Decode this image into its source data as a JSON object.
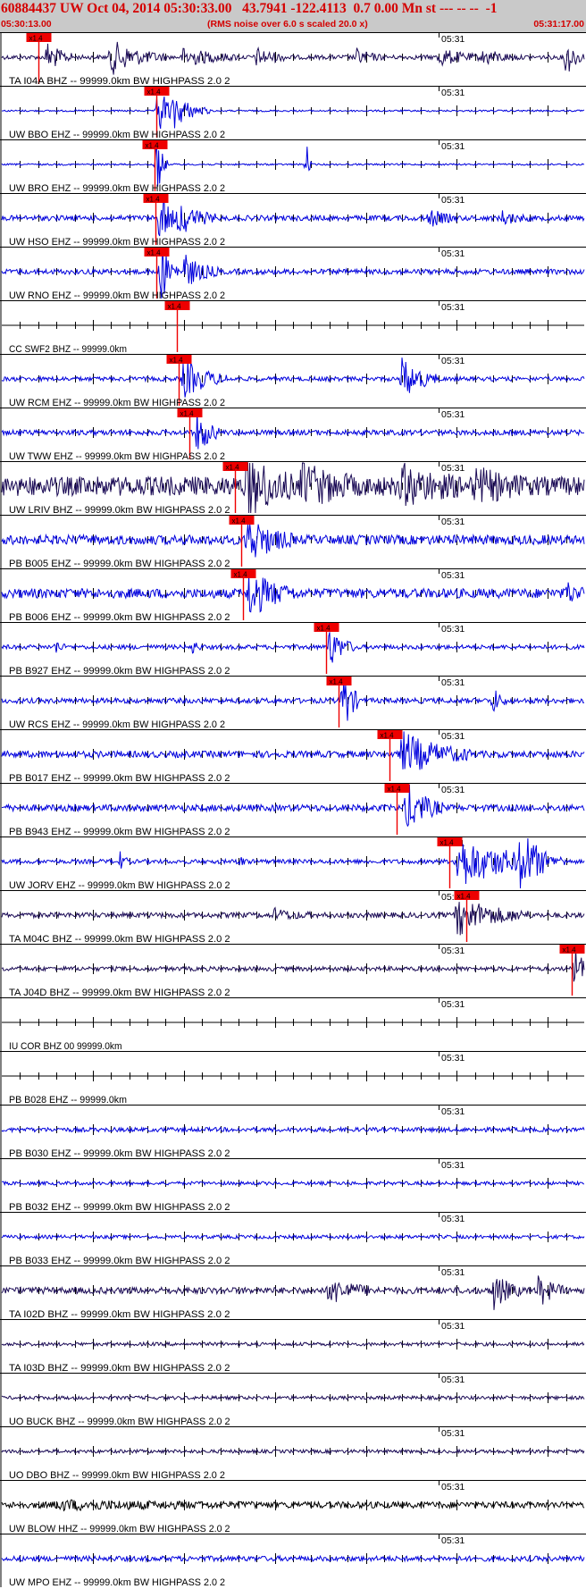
{
  "header": {
    "title": "60884437 UW Oct 04, 2014 05:30:33.00   43.7941 -122.4113  0.7 0.00 Mn st --- -- --  -1",
    "start_time": "05:30:13.00",
    "noise_note": "(RMS noise over 6.0 s scaled 20.0 x)",
    "end_time": "05:31:17.00"
  },
  "colors": {
    "header_bg": "#c9c9c9",
    "header_text": "#d40000",
    "trace_blue": "#0000dd",
    "trace_dark": "#1a0a55",
    "pick": "#ee0000",
    "axis": "#000000"
  },
  "chart_data": {
    "type": "seismogram",
    "time_range": [
      "05:30:13.00",
      "05:31:17.00"
    ],
    "time_tick_label": "05:31",
    "pick_label": "x1.4",
    "channels": [
      {
        "label": "TA I04A BHZ -- 99999.0km BW  HIGHPASS  2.0  2",
        "color": "dark",
        "pick_s": 4.0,
        "noise": 0.1,
        "bursts": [
          [
            5,
            3,
            0.7
          ],
          [
            12,
            6,
            0.8
          ],
          [
            20,
            6,
            0.45
          ],
          [
            28,
            4,
            0.4
          ],
          [
            39,
            3,
            0.35
          ],
          [
            48,
            5,
            0.4
          ],
          [
            53,
            4,
            0.35
          ],
          [
            62,
            2,
            0.9
          ]
        ]
      },
      {
        "label": "UW BBO EHZ -- 99999.0km BW  HIGHPASS  2.0  2",
        "color": "blue",
        "pick_s": 17.0,
        "noise": 0.04,
        "bursts": [
          [
            17.2,
            2,
            1.5
          ],
          [
            19,
            4,
            0.8
          ]
        ]
      },
      {
        "label": "UW BRO EHZ -- 99999.0km BW  HIGHPASS  2.0  2",
        "color": "blue",
        "pick_s": 16.8,
        "noise": 0.04,
        "bursts": [
          [
            17.0,
            1.2,
            1.6
          ],
          [
            33.5,
            0.5,
            1.0
          ]
        ]
      },
      {
        "label": "UW HSO EHZ -- 99999.0km BW  HIGHPASS  2.0  2",
        "color": "blue",
        "pick_s": 16.9,
        "noise": 0.12,
        "bursts": [
          [
            17.4,
            2,
            1.4
          ],
          [
            19.5,
            4,
            0.8
          ],
          [
            47,
            3,
            0.4
          ],
          [
            55,
            3,
            0.3
          ]
        ]
      },
      {
        "label": "UW RNO EHZ -- 99999.0km BW  HIGHPASS  2.0  2",
        "color": "blue",
        "pick_s": 17.0,
        "noise": 0.12,
        "bursts": [
          [
            17.5,
            2,
            1.5
          ],
          [
            20,
            4,
            0.8
          ]
        ]
      },
      {
        "label": "CC SWF2 BHZ -- 99999.0km",
        "color": "blue",
        "pick_s": 19.2,
        "noise": 0.0,
        "bursts": []
      },
      {
        "label": "UW RCM EHZ -- 99999.0km BW  HIGHPASS  2.0  2",
        "color": "blue",
        "pick_s": 19.4,
        "noise": 0.1,
        "bursts": [
          [
            20,
            5,
            0.9
          ],
          [
            44,
            4,
            1.0
          ]
        ]
      },
      {
        "label": "UW TWW EHZ -- 99999.0km BW  HIGHPASS  2.0  2",
        "color": "blue",
        "pick_s": 20.6,
        "noise": 0.12,
        "bursts": [
          [
            21.5,
            2.5,
            1.1
          ]
        ]
      },
      {
        "label": "UW LRIV BHZ -- 99999.0km BW  HIGHPASS  2.0  2",
        "color": "dark",
        "pick_s": 25.6,
        "noise": 0.45,
        "bursts": [
          [
            27,
            5,
            1.5
          ],
          [
            33,
            6,
            0.9
          ],
          [
            44,
            7,
            0.7
          ],
          [
            52,
            6,
            0.6
          ]
        ]
      },
      {
        "label": "PB B005 EHZ -- 99999.0km BW  HIGHPASS  2.0  2",
        "color": "blue",
        "pick_s": 26.3,
        "noise": 0.22,
        "bursts": [
          [
            27,
            5,
            1.1
          ]
        ]
      },
      {
        "label": "PB B006 EHZ -- 99999.0km BW  HIGHPASS  2.0  2",
        "color": "blue",
        "pick_s": 26.5,
        "noise": 0.22,
        "bursts": [
          [
            27.2,
            5,
            1.1
          ],
          [
            62,
            2,
            0.5
          ]
        ]
      },
      {
        "label": "PB B927 EHZ -- 99999.0km BW  HIGHPASS  2.0  2",
        "color": "blue",
        "pick_s": 35.6,
        "noise": 0.1,
        "bursts": [
          [
            6,
            1,
            0.3
          ],
          [
            21,
            1,
            0.3
          ],
          [
            36,
            3,
            0.9
          ]
        ]
      },
      {
        "label": "UW RCS EHZ -- 99999.0km BW  HIGHPASS  2.0  2",
        "color": "blue",
        "pick_s": 37.0,
        "noise": 0.12,
        "bursts": [
          [
            37.5,
            2,
            1.5
          ],
          [
            54,
            1.5,
            0.6
          ]
        ]
      },
      {
        "label": "PB B017 EHZ -- 99999.0km BW  HIGHPASS  2.0  2",
        "color": "blue",
        "pick_s": 42.6,
        "noise": 0.15,
        "bursts": [
          [
            44,
            8,
            1.0
          ]
        ]
      },
      {
        "label": "PB B943 EHZ -- 99999.0km BW  HIGHPASS  2.0  2",
        "color": "blue",
        "pick_s": 43.4,
        "noise": 0.15,
        "bursts": [
          [
            44.5,
            4,
            1.2
          ]
        ]
      },
      {
        "label": "UW JORV EHZ -- 99999.0km BW  HIGHPASS  2.0  2",
        "color": "blue",
        "pick_s": 49.2,
        "noise": 0.1,
        "bursts": [
          [
            13,
            1,
            0.4
          ],
          [
            26,
            1,
            0.3
          ],
          [
            50,
            12,
            1.2
          ],
          [
            57,
            3,
            1.6
          ]
        ]
      },
      {
        "label": "TA M04C BHZ -- 99999.0km BW  HIGHPASS  2.0  2",
        "color": "dark",
        "pick_s": 51.0,
        "noise": 0.12,
        "bursts": [
          [
            30,
            4,
            0.25
          ],
          [
            50,
            8,
            0.9
          ]
        ]
      },
      {
        "label": "TA J04D BHZ -- 99999.0km BW  HIGHPASS  2.0  2",
        "color": "dark",
        "pick_s": 62.6,
        "noise": 0.1,
        "bursts": [
          [
            63,
            1.5,
            1.3
          ]
        ]
      },
      {
        "label": "IU COR BHZ 00 99999.0km",
        "color": "blue",
        "pick_s": null,
        "noise": 0.0,
        "bursts": []
      },
      {
        "label": "PB B028 EHZ -- 99999.0km",
        "color": "blue",
        "pick_s": null,
        "noise": 0.0,
        "bursts": []
      },
      {
        "label": "PB B030 EHZ -- 99999.0km BW  HIGHPASS  2.0  2",
        "color": "blue",
        "pick_s": null,
        "noise": 0.1,
        "bursts": []
      },
      {
        "label": "PB B032 EHZ -- 99999.0km BW  HIGHPASS  2.0  2",
        "color": "blue",
        "pick_s": null,
        "noise": 0.08,
        "bursts": []
      },
      {
        "label": "PB B033 EHZ -- 99999.0km BW  HIGHPASS  2.0  2",
        "color": "blue",
        "pick_s": null,
        "noise": 0.08,
        "bursts": []
      },
      {
        "label": "TA I02D BHZ -- 99999.0km BW  HIGHPASS  2.0  2",
        "color": "dark",
        "pick_s": null,
        "noise": 0.15,
        "bursts": [
          [
            36,
            5,
            0.6
          ],
          [
            54,
            3,
            0.9
          ],
          [
            59,
            3,
            0.7
          ]
        ]
      },
      {
        "label": "TA I03D BHZ -- 99999.0km BW  HIGHPASS  2.0  2",
        "color": "dark",
        "pick_s": null,
        "noise": 0.08,
        "bursts": []
      },
      {
        "label": "UO BUCK BHZ -- 99999.0km BW  HIGHPASS  2.0  2",
        "color": "dark",
        "pick_s": null,
        "noise": 0.08,
        "bursts": []
      },
      {
        "label": "UO DBO BHZ -- 99999.0km BW  HIGHPASS  2.0  2",
        "color": "dark",
        "pick_s": null,
        "noise": 0.08,
        "bursts": []
      },
      {
        "label": "UW BLOW HHZ -- 99999.0km BW  HIGHPASS  2.0  2",
        "color": "black",
        "pick_s": null,
        "noise": 0.15,
        "bursts": [
          [
            6,
            22,
            0.15
          ]
        ]
      },
      {
        "label": "UW MPO EHZ -- 99999.0km BW  HIGHPASS  2.0  2",
        "color": "blue",
        "pick_s": null,
        "noise": 0.12,
        "bursts": []
      }
    ]
  }
}
